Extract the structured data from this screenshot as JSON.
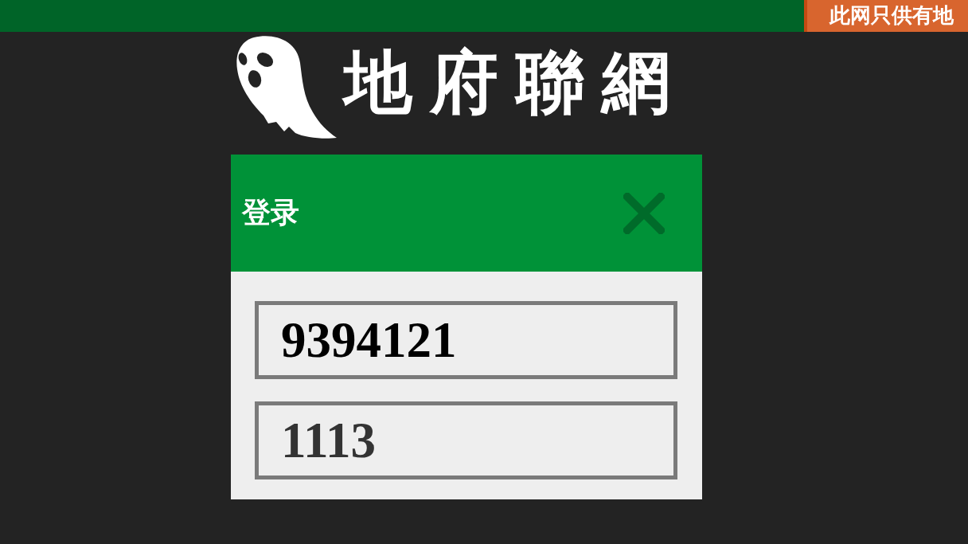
{
  "top_bar": {
    "notice": "此网只供有地"
  },
  "logo": {
    "title": "地府聯網"
  },
  "login_dialog": {
    "title": "登录",
    "fields": [
      {
        "value": "9394121"
      },
      {
        "placeholder": "1113"
      }
    ]
  }
}
